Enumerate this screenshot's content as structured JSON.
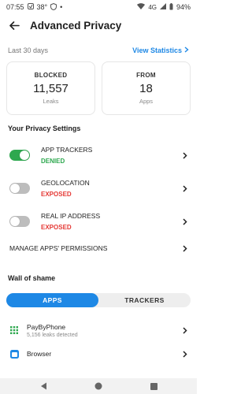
{
  "status_bar": {
    "time": "07:55",
    "temperature": "38°",
    "network": "4G",
    "battery": "94%"
  },
  "header": {
    "title": "Advanced Privacy"
  },
  "period": {
    "label": "Last 30 days",
    "view_stats": "View Statistics"
  },
  "stats": {
    "blocked": {
      "label": "BLOCKED",
      "value": "11,557",
      "unit": "Leaks"
    },
    "from": {
      "label": "FROM",
      "value": "18",
      "unit": "Apps"
    }
  },
  "privacy_settings": {
    "title": "Your Privacy Settings",
    "items": [
      {
        "name": "APP TRACKERS",
        "status": "DENIED",
        "enabled": true
      },
      {
        "name": "GEOLOCATION",
        "status": "EXPOSED",
        "enabled": false
      },
      {
        "name": "REAL IP ADDRESS",
        "status": "EXPOSED",
        "enabled": false
      }
    ],
    "manage_label": "MANAGE APPS' PERMISSIONS"
  },
  "wall_of_shame": {
    "title": "Wall of shame",
    "tabs": [
      "APPS",
      "TRACKERS"
    ],
    "active_tab": "APPS",
    "apps": [
      {
        "name": "PayByPhone",
        "leaks": "5,156 leaks detected"
      },
      {
        "name": "Browser",
        "leaks": ""
      }
    ]
  },
  "colors": {
    "accent": "#1e88e5",
    "denied": "#2ea84f",
    "exposed": "#e53935"
  }
}
